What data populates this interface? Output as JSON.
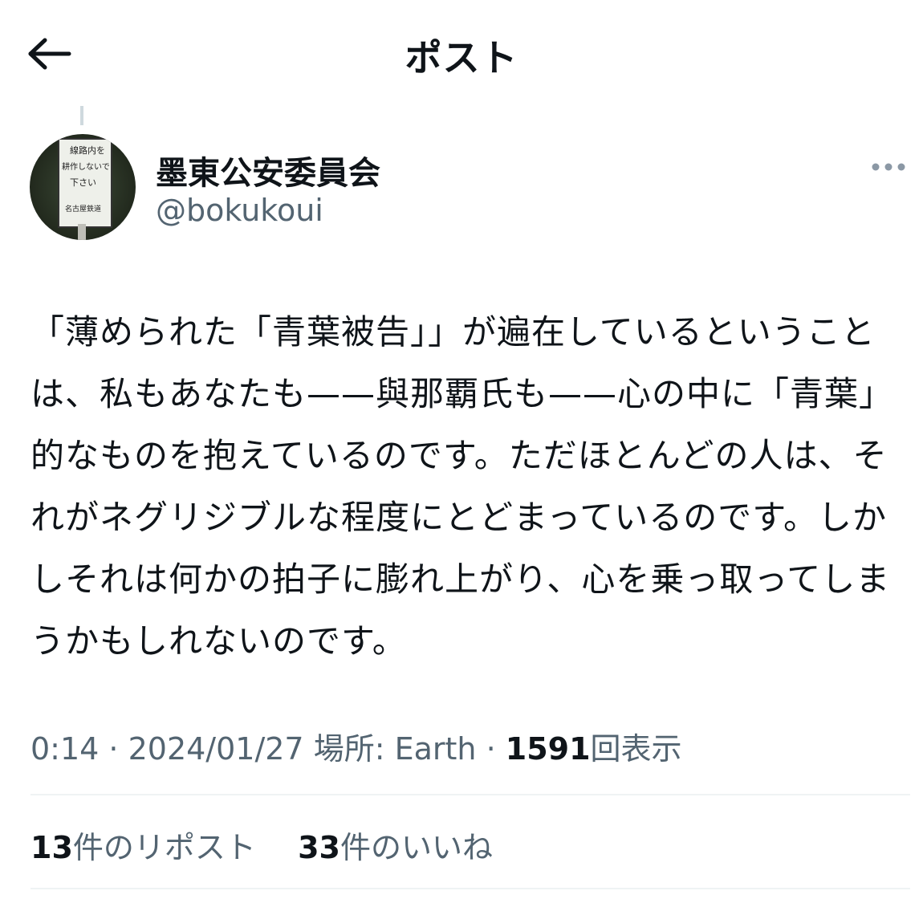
{
  "header": {
    "title": "ポスト",
    "back_icon": "arrow-left-icon"
  },
  "author": {
    "display_name": "墨東公安委員会",
    "handle": "@bokukoui",
    "avatar_sign_text": [
      "線路内を",
      "耕作しないで",
      "下さい",
      "名古屋鉄道"
    ]
  },
  "more_icon": "more-horizontal-icon",
  "post": {
    "text": "「薄められた「青葉被告」」が遍在しているということは、私もあなたも——與那覇氏も——心の中に「青葉」的なものを抱えているのです。ただほとんどの人は、それがネグリジブルな程度にとどまっているのです。しかしそれは何かの拍子に膨れ上がり、心を乗っ取ってしまうかもしれないのです。"
  },
  "meta": {
    "time": "0:14",
    "sep1": " · ",
    "date": "2024/01/27",
    "location": " 場所: Earth",
    "sep2": " · ",
    "views_count": "1591",
    "views_label": "回表示"
  },
  "stats": {
    "reposts_count": "13",
    "reposts_label": "件のリポスト",
    "likes_count": "33",
    "likes_label": "件のいいね"
  },
  "colors": {
    "text_primary": "#0f1419",
    "text_secondary": "#536471",
    "divider": "#eff3f4"
  }
}
